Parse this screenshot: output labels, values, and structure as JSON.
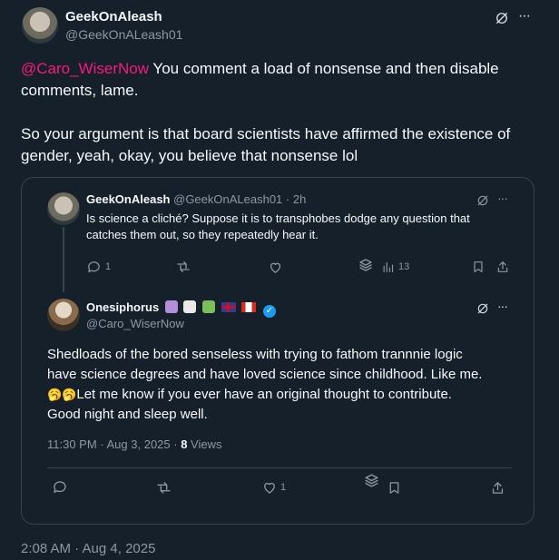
{
  "tweet": {
    "author_name": "GeekOnAleash",
    "author_handle": "@GeekOnALeash01",
    "mention": "@Caro_WiserNow",
    "text_line1_rest": " You comment a load of nonsense and then disable",
    "text_line2": "comments, lame.",
    "text_para2_line1": "So your argument is that board scientists have affirmed the existence of",
    "text_para2_line2": "gender, yeah, okay, you believe that nonsense lol",
    "timestamp": "2:08 AM · Aug 4, 2025",
    "more_label": "···"
  },
  "quoted_parent": {
    "author_name": "GeekOnAleash",
    "author_handle": "@GeekOnALeash01",
    "time": "· 2h",
    "text_line1": "Is science a cliché? Suppose it is to transphobes dodge any question that",
    "text_line2": "catches them out, so they repeatedly hear it.",
    "reply_count": "1",
    "views_count": "13",
    "more_label": "···"
  },
  "quoted_reply": {
    "author_name": "Onesiphorus",
    "author_handle": "@Caro_WiserNow",
    "text_line1": "Shedloads of the bored senseless with trying to fathom trannnie logic",
    "text_line2": "have science degrees and have loved science since childhood. Like me.",
    "emoji": "🥱🥱",
    "text_line3_rest": "Let me know if you ever have an original thought to contribute.",
    "text_line4": "Good night and sleep well.",
    "meta_time": "11:30 PM · Aug 3, 2025 · ",
    "meta_views_count": "8",
    "meta_views_label": " Views",
    "like_count": "1",
    "more_label": "···"
  },
  "colors": {
    "background": "#15202b",
    "text": "#f7f9f9",
    "muted": "#8b98a5",
    "mention": "#f91880",
    "border": "#38444d",
    "verified": "#1d9bf0"
  }
}
